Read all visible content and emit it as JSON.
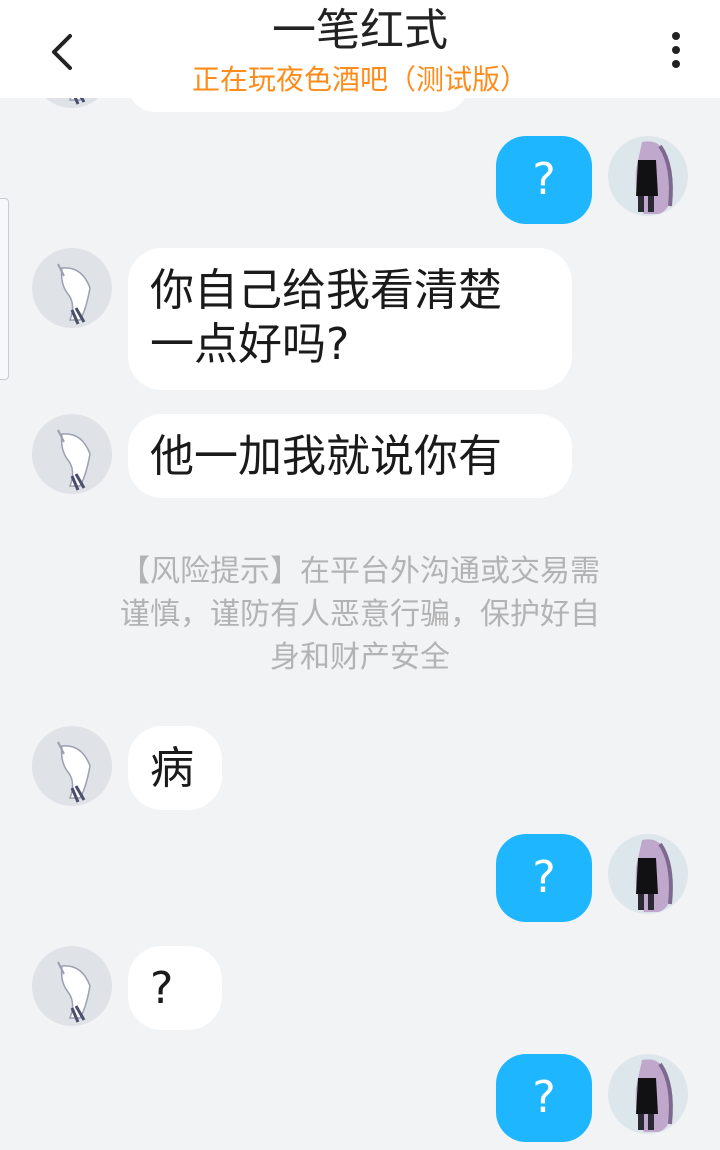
{
  "header": {
    "title": "一笔红式",
    "subtitle": "正在玩夜色酒吧（测试版）",
    "back_icon": "chevron-left-icon",
    "menu_icon": "more-vertical-icon"
  },
  "messages": [
    {
      "from": "self",
      "text": "?"
    },
    {
      "from": "other",
      "text_line1": "你自己给我看清楚",
      "text_line2": "一点好吗?"
    },
    {
      "from": "other",
      "text": "他一加我就说你有"
    },
    {
      "from": "other",
      "text": "病"
    },
    {
      "from": "self",
      "text": "?"
    },
    {
      "from": "other",
      "text": "?"
    },
    {
      "from": "self",
      "text": "?"
    }
  ],
  "notice": {
    "line1": "【风险提示】在平台外沟通或交易需",
    "line2": "谨慎，谨防有人恶意行骗，保护好自",
    "line3": "身和财产安全"
  },
  "colors": {
    "accent": "#1eb7ff",
    "subtitle": "#ff8c1a",
    "background": "#f2f3f5"
  }
}
